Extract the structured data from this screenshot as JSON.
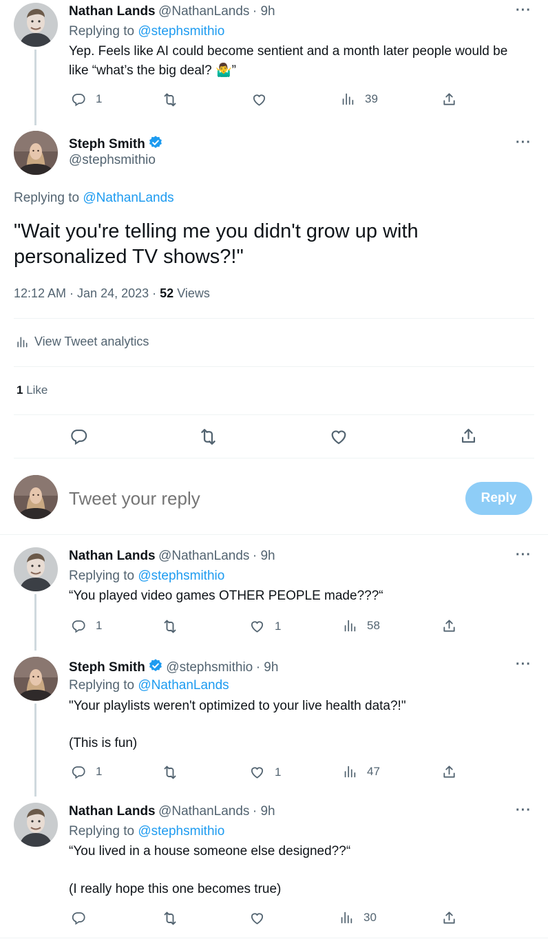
{
  "tweets": {
    "t1": {
      "name": "Nathan Lands",
      "handle": "@NathanLands",
      "time": "· 9h",
      "replying_prefix": "Replying to",
      "replying_to": "@stephsmithio",
      "line1": "Yep. Feels like AI could become sentient and a month later people would be",
      "line2_pre": "like “what’s the big deal? ",
      "line2_emoji": "🤷‍♂️",
      "line2_post": "”",
      "replies": "1",
      "views": "39"
    },
    "main": {
      "name": "Steph Smith",
      "handle": "@stephsmithio",
      "replying_prefix": "Replying to",
      "replying_to": "@NathanLands",
      "text_line1": "\"Wait you're telling me you didn't grow up with",
      "text_line2": "personalized TV shows?!\"",
      "timestamp": "12:12 AM · Jan 24, 2023 ·",
      "views_count": "52",
      "views_label": "Views",
      "analytics_label": "View Tweet analytics",
      "likes_count": "1",
      "likes_label": "Like"
    },
    "compose": {
      "placeholder": "Tweet your reply",
      "reply_button": "Reply"
    },
    "t2": {
      "name": "Nathan Lands",
      "handle": "@NathanLands",
      "time": "· 9h",
      "replying_prefix": "Replying to",
      "replying_to": "@stephsmithio",
      "text": "“You played video games OTHER PEOPLE made???“",
      "replies": "1",
      "likes": "1",
      "views": "58"
    },
    "t3": {
      "name": "Steph Smith",
      "handle": "@stephsmithio",
      "time": "· 9h",
      "replying_prefix": "Replying to",
      "replying_to": "@NathanLands",
      "text1": "\"Your playlists weren't optimized to your live health data?!\"",
      "text2": "(This is fun)",
      "replies": "1",
      "likes": "1",
      "views": "47"
    },
    "t4": {
      "name": "Nathan Lands",
      "handle": "@NathanLands",
      "time": "· 9h",
      "replying_prefix": "Replying to",
      "replying_to": "@stephsmithio",
      "text1": "“You lived in a house someone else designed??“",
      "text2": "(I really hope this one becomes true)",
      "views": "30"
    }
  },
  "more_label": "···",
  "colors": {
    "accent": "#1d9bf0",
    "secondary": "#536471",
    "reply_button": "#8ecdf7"
  }
}
